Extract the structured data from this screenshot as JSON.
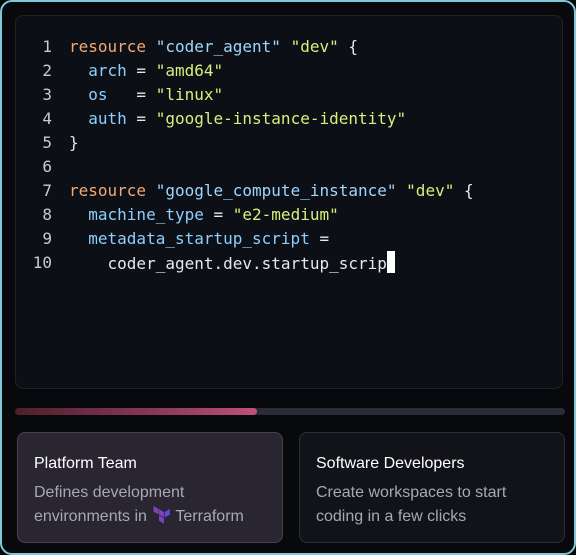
{
  "editor": {
    "lines": [
      {
        "num": "1",
        "parts": [
          [
            "kw",
            "resource"
          ],
          [
            "plain",
            " "
          ],
          [
            "str",
            "\"coder_agent\""
          ],
          [
            "plain",
            " "
          ],
          [
            "val",
            "\"dev\""
          ],
          [
            "plain",
            " {"
          ]
        ]
      },
      {
        "num": "2",
        "parts": [
          [
            "plain",
            "  "
          ],
          [
            "attr",
            "arch"
          ],
          [
            "plain",
            " = "
          ],
          [
            "val",
            "\"amd64\""
          ]
        ]
      },
      {
        "num": "3",
        "parts": [
          [
            "plain",
            "  "
          ],
          [
            "attr",
            "os"
          ],
          [
            "plain",
            "   = "
          ],
          [
            "val",
            "\"linux\""
          ]
        ]
      },
      {
        "num": "4",
        "parts": [
          [
            "plain",
            "  "
          ],
          [
            "attr",
            "auth"
          ],
          [
            "plain",
            " = "
          ],
          [
            "val",
            "\"google-instance-identity\""
          ]
        ]
      },
      {
        "num": "5",
        "parts": [
          [
            "plain",
            "}"
          ]
        ]
      },
      {
        "num": "6",
        "parts": []
      },
      {
        "num": "7",
        "parts": [
          [
            "kw",
            "resource"
          ],
          [
            "plain",
            " "
          ],
          [
            "str",
            "\"google_compute_instance\""
          ],
          [
            "plain",
            " "
          ],
          [
            "val",
            "\"dev\""
          ],
          [
            "plain",
            " {"
          ]
        ]
      },
      {
        "num": "8",
        "parts": [
          [
            "plain",
            "  "
          ],
          [
            "attr",
            "machine_type"
          ],
          [
            "plain",
            " = "
          ],
          [
            "val",
            "\"e2-medium\""
          ]
        ]
      },
      {
        "num": "9",
        "parts": [
          [
            "plain",
            "  "
          ],
          [
            "attr",
            "metadata_startup_script"
          ],
          [
            "plain",
            " ="
          ]
        ]
      },
      {
        "num": "10",
        "parts": [
          [
            "plain",
            "    coder_agent.dev.startup_scrip"
          ]
        ],
        "cursor": true
      }
    ]
  },
  "progress": {
    "fraction": 0.44
  },
  "cards": {
    "platform": {
      "title": "Platform Team",
      "desc_before": "Defines development environments in",
      "desc_brand": "Terraform",
      "icon": "terraform-icon"
    },
    "developers": {
      "title": "Software Developers",
      "desc": "Create workspaces to start coding in a few clicks"
    }
  },
  "colors": {
    "keyword": "#f2a877",
    "string": "#9ed6ff",
    "value": "#d8f07a",
    "attribute": "#8ccfff",
    "border_accent": "#7ec9d8",
    "terraform": "#7b42bc"
  }
}
